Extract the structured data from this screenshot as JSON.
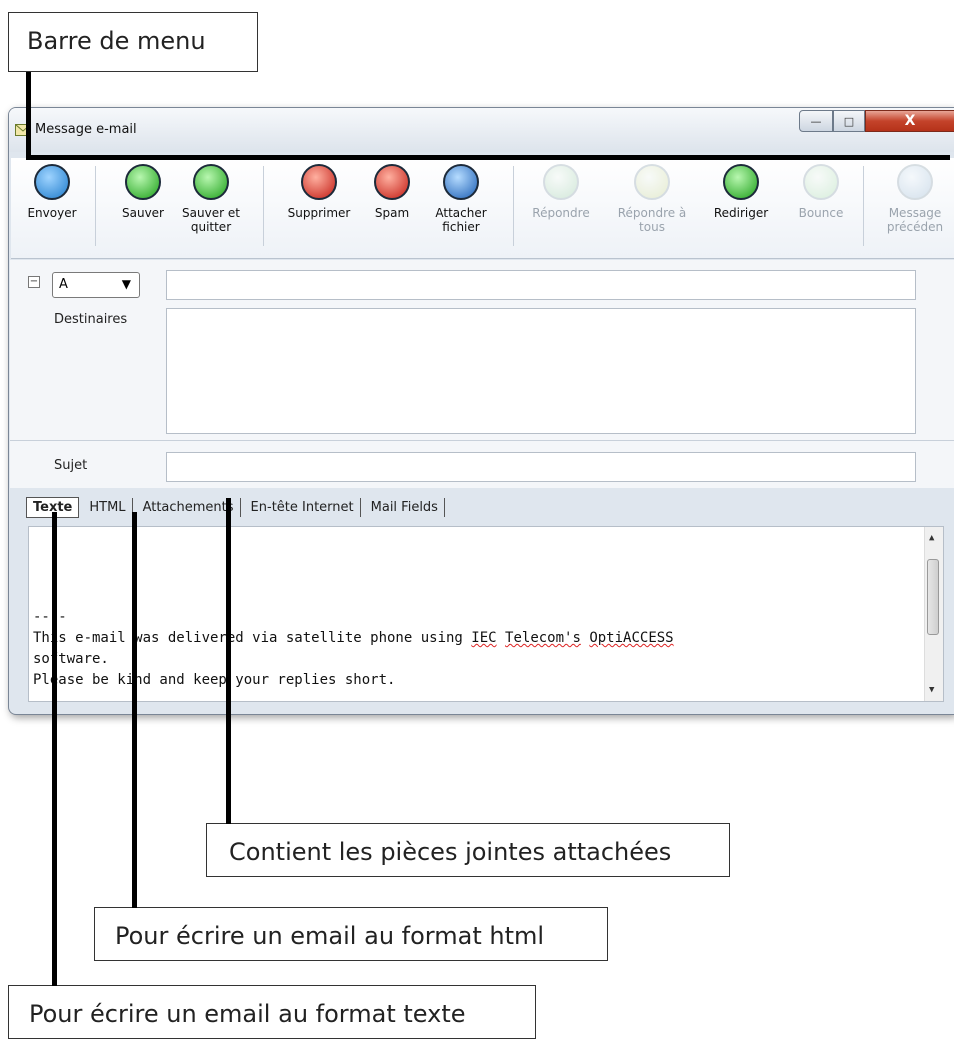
{
  "callouts": {
    "menu_bar": "Barre de menu",
    "attachments": "Contient les pièces jointes attachées",
    "html_format": "Pour écrire un email au format html",
    "text_format": "Pour écrire un email au format texte"
  },
  "window": {
    "title": "Message e-mail",
    "controls": {
      "minimize": "—",
      "maximize": "□",
      "close": "X"
    }
  },
  "toolbar": {
    "envoyer": "Envoyer",
    "sauver": "Sauver",
    "sauver_quitter": "Sauver et quitter",
    "supprimer": "Supprimer",
    "spam": "Spam",
    "attacher": "Attacher fichier",
    "repondre": "Répondre",
    "repondre_tous": "Répondre à tous",
    "rediriger": "Rediriger",
    "bounce": "Bounce",
    "message_prec": "Message précéden"
  },
  "form": {
    "collapse": "−",
    "recipient_type": "A",
    "recipients_label": "Destinaires",
    "subject_label": "Sujet"
  },
  "tabs": [
    "Texte",
    "HTML",
    "Attachements",
    "En-tête Internet",
    "Mail Fields"
  ],
  "body": {
    "separator": "----",
    "line1_a": "This e-mail was delivered via satellite phone using ",
    "line1_b": "IEC",
    "line1_c": " ",
    "line1_d": "Telecom's",
    "line1_e": " ",
    "line1_f": "OptiACCESS",
    "line2": "software.",
    "line3": "Please be kind and keep your replies short."
  }
}
